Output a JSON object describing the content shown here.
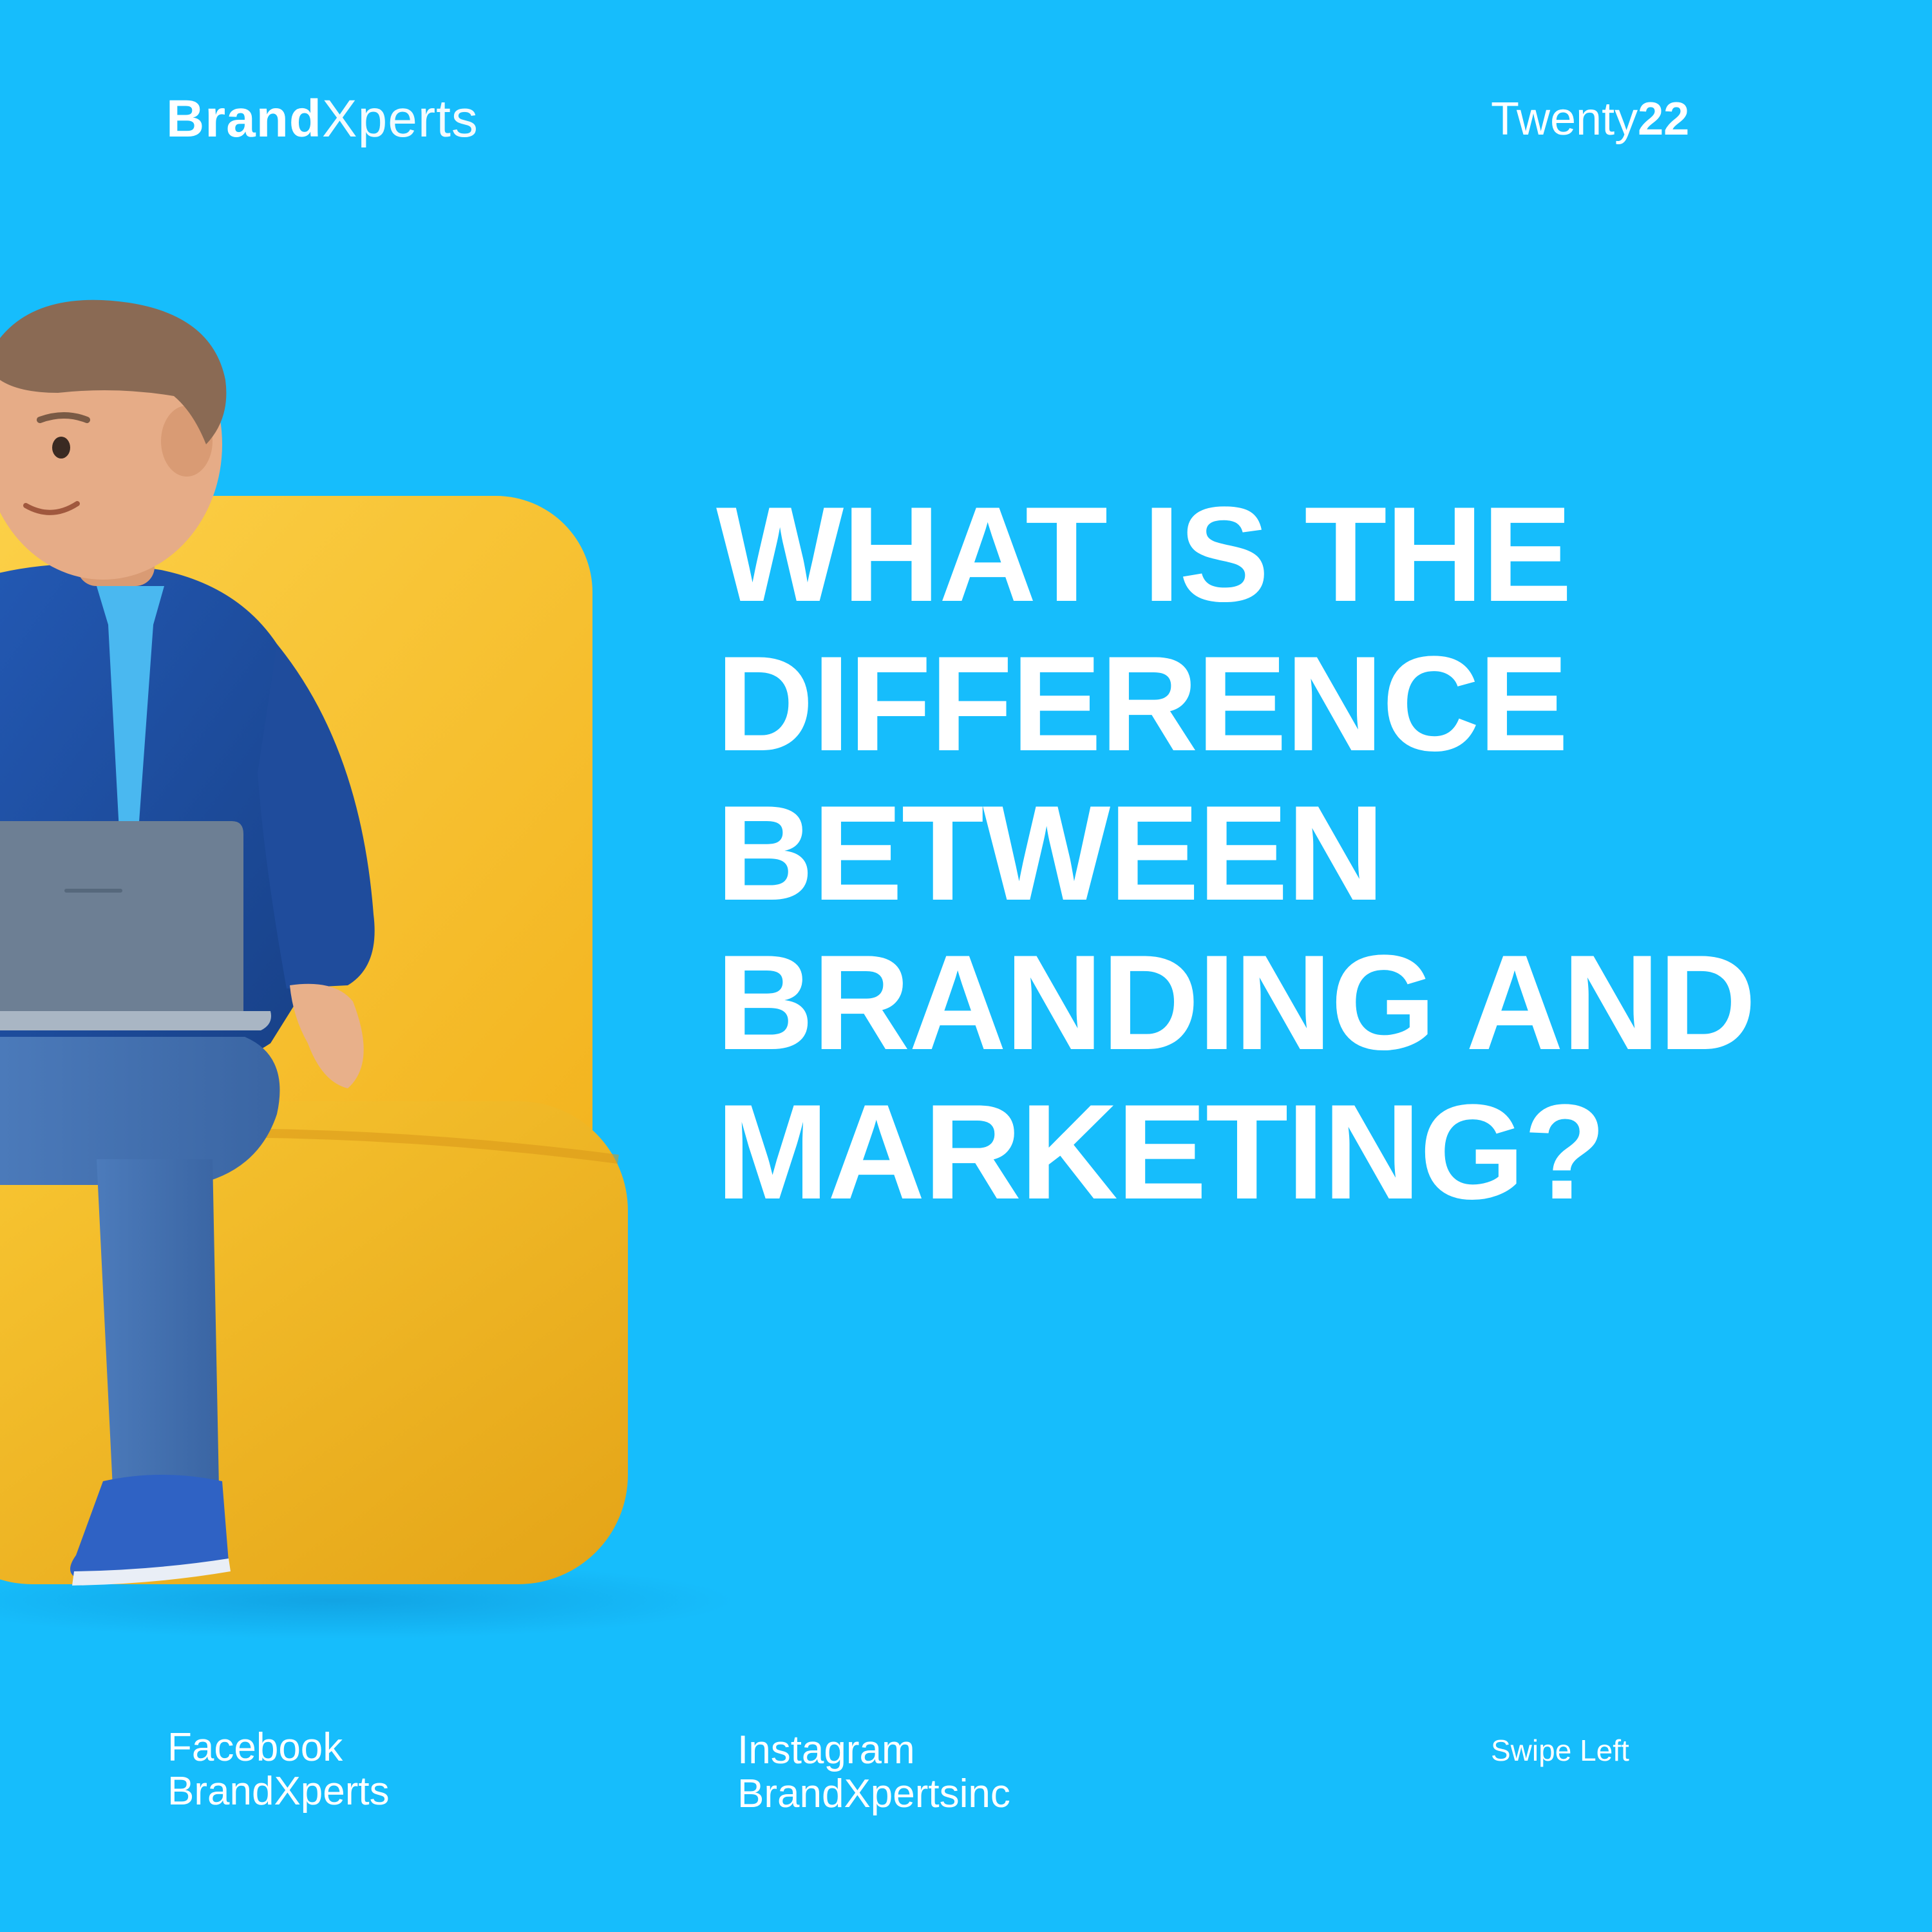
{
  "brand": {
    "bold": "Brand",
    "light": "Xperts"
  },
  "year": {
    "word": "Twenty",
    "number": "22"
  },
  "headline": {
    "lines": [
      "WHAT IS THE",
      "DIFFERENCE",
      "BETWEEN",
      "BRANDING AND",
      "MARKETING?"
    ]
  },
  "footer": {
    "facebook": {
      "label": "Facebook",
      "handle": "BrandXperts"
    },
    "instagram": {
      "label": "Instagram",
      "handle": "BrandXpertsinc"
    },
    "swipe": "Swipe Left"
  },
  "colors": {
    "background": "#16BDFC",
    "text": "#FFFFFF",
    "chair": "#F7C42C",
    "suit": "#1E4F9E"
  },
  "illustration": {
    "icon": "businessman-on-chair-with-laptop-illustration"
  }
}
